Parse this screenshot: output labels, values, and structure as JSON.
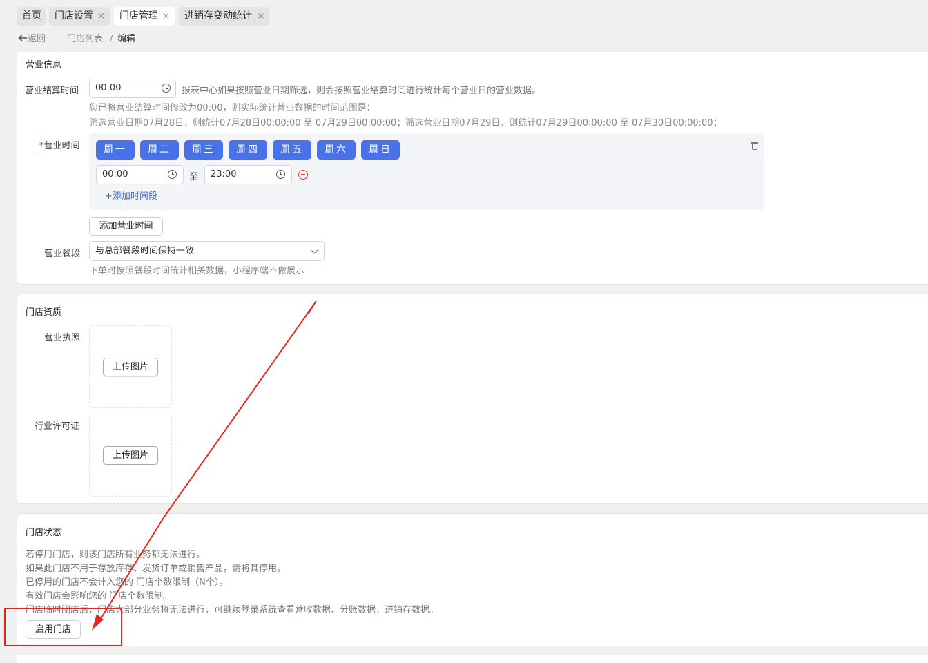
{
  "tabs": [
    {
      "label": "首页",
      "closable": false,
      "active": false
    },
    {
      "label": "门店设置",
      "closable": true,
      "active": false
    },
    {
      "label": "门店管理",
      "closable": true,
      "active": true
    },
    {
      "label": "进销存变动统计",
      "closable": true,
      "active": false
    }
  ],
  "tab_close_glyph": "×",
  "breadcrumb": {
    "back": "返回",
    "parent": "门店列表",
    "separator": "/",
    "current": "编辑"
  },
  "business": {
    "title": "营业信息",
    "settle_label": "营业结算时间",
    "settle_value": "00:00",
    "settle_hint": "报表中心如果按照营业日期筛选，则会按照营业结算时间进行统计每个营业日的营业数据。",
    "settle_note1": "您已将营业结算时间修改为00:00，则实际统计营业数据的时间范围是：",
    "settle_note2": "筛选营业日期07月28日，则统计07月28日00:00:00 至 07月29日00:00:00；筛选营业日期07月29日，则统计07月29日00:00:00 至 07月30日00:00:00；",
    "hours_required_mark": "*",
    "hours_label": "营业时间",
    "days": [
      "周一",
      "周二",
      "周三",
      "周四",
      "周五",
      "周六",
      "周日"
    ],
    "start_time": "00:00",
    "to_label": "至",
    "end_time": "23:00",
    "add_period": "+添加时间段",
    "add_hours_button": "添加营业时间",
    "meal_label": "营业餐段",
    "meal_value": "与总部餐段时间保持一致",
    "meal_hint": "下单时按照餐段时间统计相关数据，小程序端不做展示"
  },
  "qualification": {
    "title": "门店资质",
    "license_label": "营业执照",
    "permit_label": "行业许可证",
    "upload_label": "上传图片"
  },
  "status": {
    "title": "门店状态",
    "lines": [
      "若停用门店，则该门店所有业务都无法进行。",
      "如果此门店不用于存放库存、发货订单或销售产品，请将其停用。",
      "已停用的门店不会计入您的 门店个数限制（N个）。",
      "有效门店会影响您的 门店个数限制。",
      "门店临时闭店后，门店大部分业务将无法进行，可继续登录系统查看营收数据、分账数据，进销存数据。"
    ],
    "enable_button": "启用门店"
  },
  "colors": {
    "accent": "#4a72e8",
    "annotation": "#e8231a",
    "danger": "#e53935"
  }
}
